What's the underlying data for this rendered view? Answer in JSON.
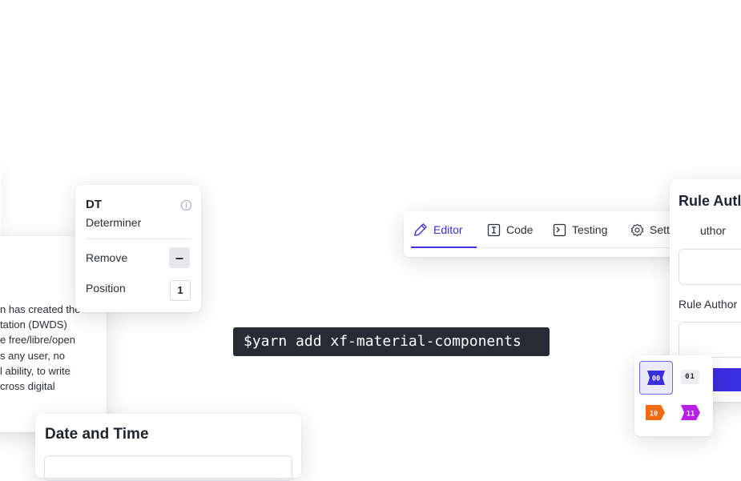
{
  "left_panel": {
    "lines": [
      "n has created the",
      "tation (DWDS)",
      "e free/libre/open",
      "s any user, no",
      "l ability, to write",
      "cross digital"
    ]
  },
  "tag_popover": {
    "tag": "DT",
    "description": "Determiner",
    "info_icon": "info-icon",
    "remove_label": "Remove",
    "remove_button_symbol": "–",
    "position_label": "Position",
    "position_value": "1"
  },
  "date_card": {
    "title": "Date and Time"
  },
  "snippet": {
    "command": "$yarn add xf-material-components"
  },
  "tabs": {
    "active": "Editor",
    "accent_color": "#4031e0",
    "items": [
      {
        "label": "Editor",
        "icon": "pencil-icon"
      },
      {
        "label": "Code",
        "icon": "text-cursor-icon"
      },
      {
        "label": "Testing",
        "icon": "terminal-icon"
      },
      {
        "label": "Settings",
        "icon": "gear-icon"
      }
    ]
  },
  "rule_card": {
    "title": "Rule Autl",
    "field1_label": "uthor",
    "field2_label": "Rule Author",
    "button_color": "#3b2de0"
  },
  "bits": {
    "items": [
      {
        "label": "00",
        "color": "#3b2de0"
      },
      {
        "label": "01",
        "color": "#eceef1"
      },
      {
        "label": "10",
        "color": "#f26a12"
      },
      {
        "label": "11",
        "color": "#b81ee6"
      }
    ]
  }
}
